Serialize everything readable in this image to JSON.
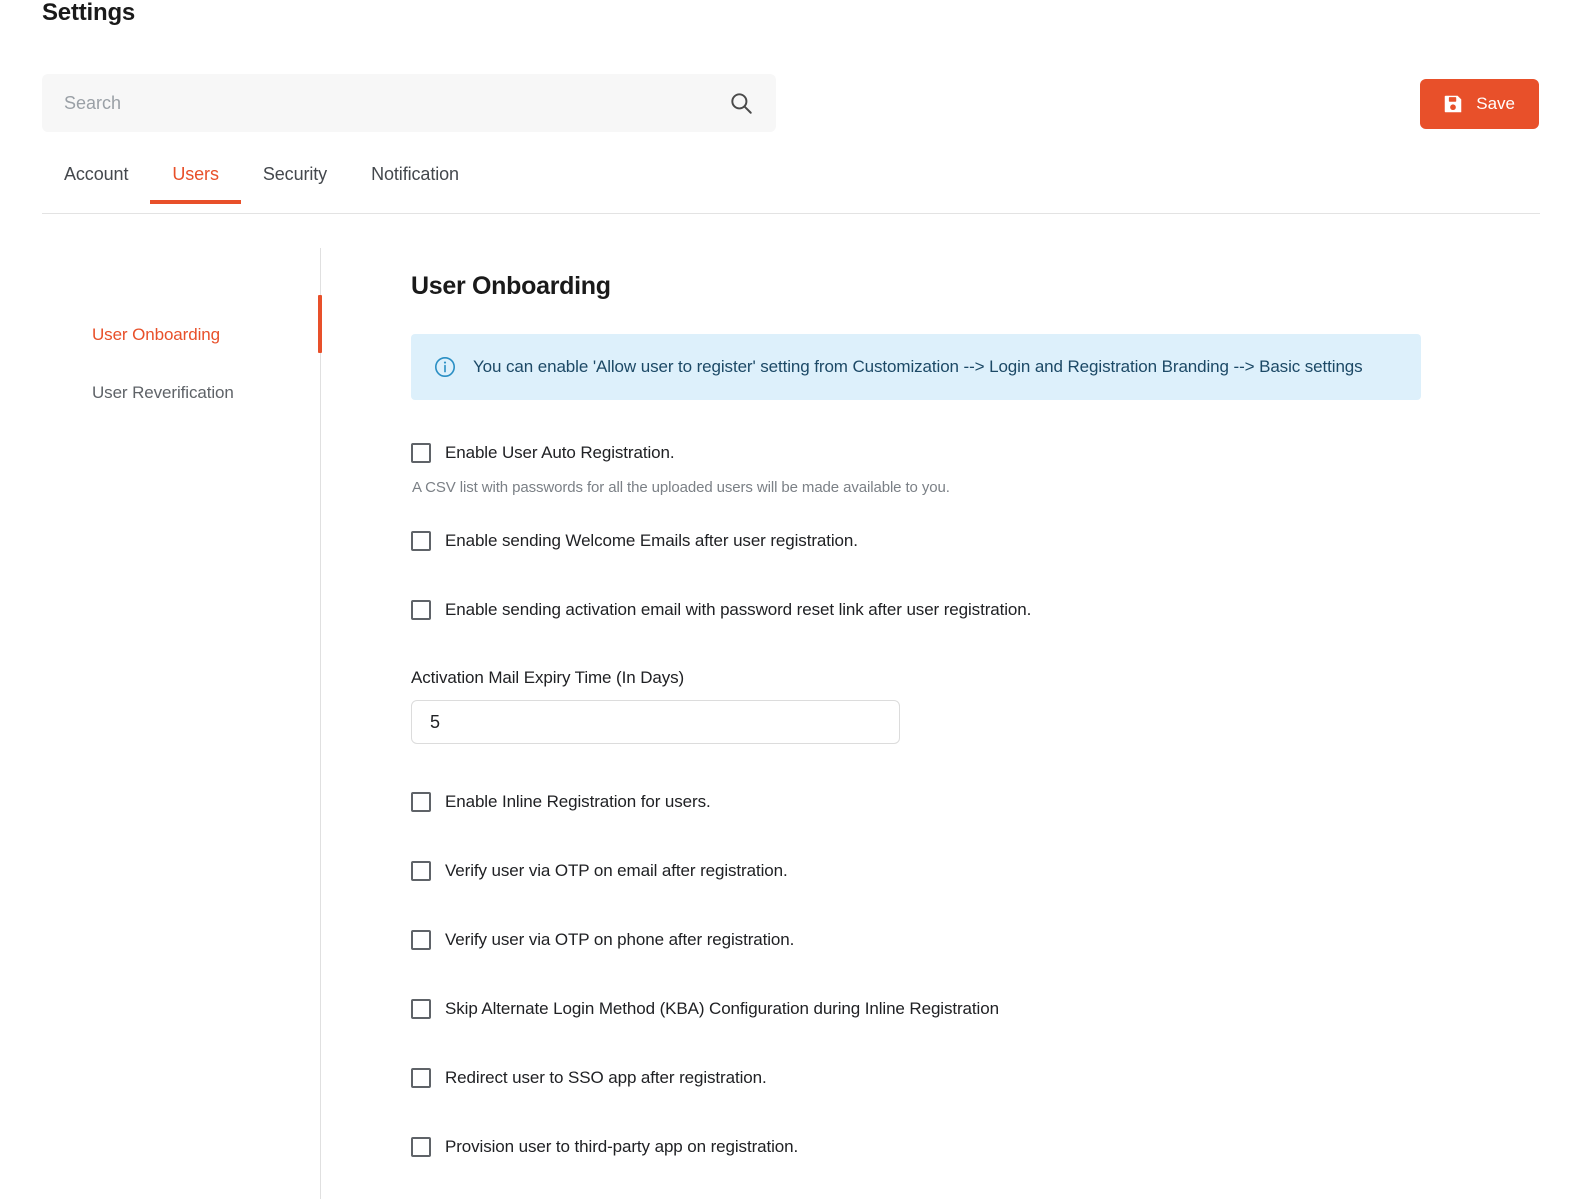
{
  "page_title": "Settings",
  "search": {
    "placeholder": "Search",
    "value": "",
    "icon": "search-icon"
  },
  "save_button": {
    "label": "Save",
    "icon": "save-icon",
    "color": "#e8502a"
  },
  "tabs": [
    {
      "label": "Account",
      "active": false
    },
    {
      "label": "Users",
      "active": true
    },
    {
      "label": "Security",
      "active": false
    },
    {
      "label": "Notification",
      "active": false
    }
  ],
  "subnav": {
    "items": [
      {
        "label": "User Onboarding",
        "active": true
      },
      {
        "label": "User Reverification",
        "active": false
      }
    ]
  },
  "main": {
    "title": "User Onboarding",
    "info_banner": {
      "icon": "info-circle-icon",
      "text": "You can enable 'Allow user to register' setting from Customization --> Login and Registration Branding --> Basic settings",
      "background": "#ddf0fb",
      "text_color": "#1c4966"
    },
    "options": [
      {
        "label": "Enable User Auto Registration.",
        "checked": false,
        "helper": "A CSV list with passwords for all the uploaded users will be made available to you."
      },
      {
        "label": "Enable sending Welcome Emails after user registration.",
        "checked": false
      },
      {
        "label": "Enable sending activation email with password reset link after user registration.",
        "checked": false
      }
    ],
    "expiry_field": {
      "label": "Activation Mail Expiry Time (In Days)",
      "value": "5"
    },
    "options2": [
      {
        "label": "Enable Inline Registration for users.",
        "checked": false
      },
      {
        "label": "Verify user via OTP on email after registration.",
        "checked": false
      },
      {
        "label": "Verify user via OTP on phone after registration.",
        "checked": false
      },
      {
        "label": "Skip Alternate Login Method (KBA) Configuration during Inline Registration",
        "checked": false
      },
      {
        "label": "Redirect user to SSO app after registration.",
        "checked": false
      },
      {
        "label": "Provision user to third-party app on registration.",
        "checked": false
      }
    ]
  }
}
